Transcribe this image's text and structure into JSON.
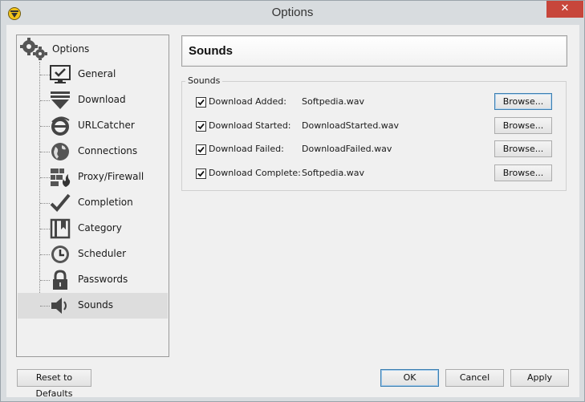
{
  "window": {
    "title": "Options",
    "close_glyph": "✕"
  },
  "tree": {
    "root_label": "Options",
    "items": [
      {
        "label": "General",
        "icon": "monitor-check-icon"
      },
      {
        "label": "Download",
        "icon": "download-arrow-icon"
      },
      {
        "label": "URLCatcher",
        "icon": "ie-logo-icon"
      },
      {
        "label": "Connections",
        "icon": "globe-icon"
      },
      {
        "label": "Proxy/Firewall",
        "icon": "firewall-icon"
      },
      {
        "label": "Completion",
        "icon": "checkmark-icon"
      },
      {
        "label": "Category",
        "icon": "bookmark-folder-icon"
      },
      {
        "label": "Scheduler",
        "icon": "clock-icon"
      },
      {
        "label": "Passwords",
        "icon": "padlock-icon"
      },
      {
        "label": "Sounds",
        "icon": "speaker-icon",
        "selected": true
      }
    ]
  },
  "panel": {
    "title": "Sounds",
    "group_label": "Sounds"
  },
  "sounds": [
    {
      "event": "Download Added:",
      "file": "Softpedia.wav",
      "checked": true,
      "button": "Browse..."
    },
    {
      "event": "Download Started:",
      "file": "DownloadStarted.wav",
      "checked": true,
      "button": "Browse..."
    },
    {
      "event": "Download Failed:",
      "file": "DownloadFailed.wav",
      "checked": true,
      "button": "Browse..."
    },
    {
      "event": "Download Complete:",
      "file": "Softpedia.wav",
      "checked": true,
      "button": "Browse..."
    }
  ],
  "footer": {
    "reset_label": "Reset to Defaults",
    "ok_label": "OK",
    "cancel_label": "Cancel",
    "apply_label": "Apply"
  },
  "colors": {
    "close_button": "#c7463b",
    "selected_item": "#dddddd",
    "focus_border": "#3c7fb1"
  }
}
